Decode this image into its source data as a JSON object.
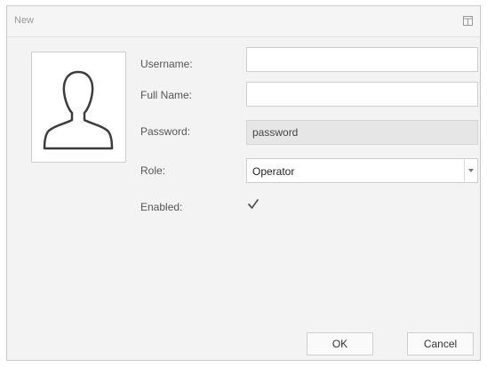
{
  "window": {
    "title": "New"
  },
  "form": {
    "username": {
      "label": "Username:",
      "value": ""
    },
    "full_name": {
      "label": "Full Name:",
      "value": ""
    },
    "password": {
      "label": "Password:",
      "value": "password"
    },
    "role": {
      "label": "Role:",
      "value": "Operator"
    },
    "enabled": {
      "label": "Enabled:",
      "checked": true
    }
  },
  "buttons": {
    "ok": "OK",
    "cancel": "Cancel"
  },
  "icons": {
    "avatar": "user-silhouette-icon",
    "maximize": "maximize-icon",
    "dropdown": "chevron-down-icon",
    "check": "checkmark-icon"
  }
}
